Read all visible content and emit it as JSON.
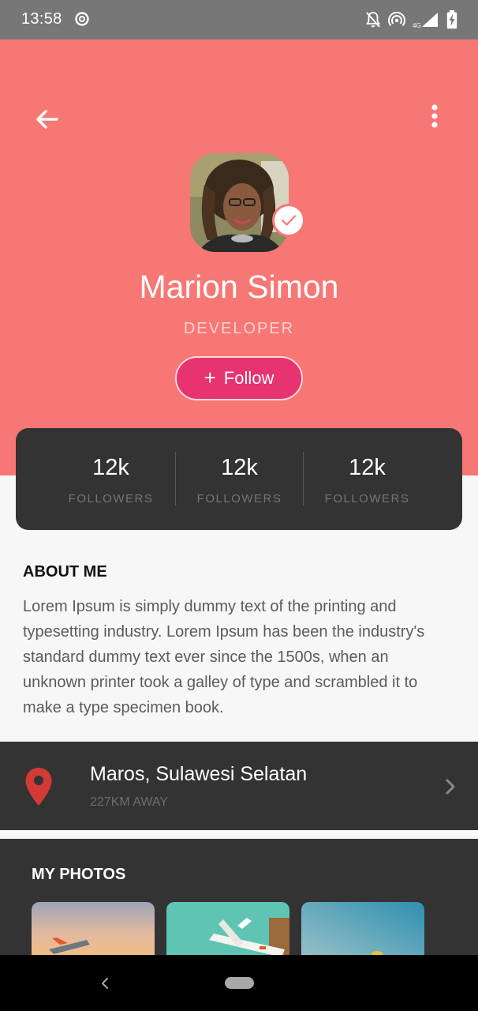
{
  "status_bar": {
    "time": "13:58",
    "network_label": "4G",
    "icons": [
      "sync-icon",
      "notifications-off-icon",
      "hotspot-icon",
      "signal-icon",
      "battery-charging-icon"
    ]
  },
  "header": {
    "back_icon": "arrow-left-icon",
    "more_icon": "more-vertical-icon",
    "background_color": "#f77775"
  },
  "profile": {
    "name": "Marion Simon",
    "role": "DEVELOPER",
    "verified": true,
    "follow_label": "Follow",
    "follow_color": "#e7336f"
  },
  "stats": [
    {
      "value": "12k",
      "label": "FOLLOWERS"
    },
    {
      "value": "12k",
      "label": "FOLLOWERS"
    },
    {
      "value": "12k",
      "label": "FOLLOWERS"
    }
  ],
  "about": {
    "title": "ABOUT ME",
    "text": "Lorem Ipsum is simply dummy text of the printing and typesetting industry. Lorem Ipsum has been the industry's standard dummy text ever since the 1500s, when an unknown printer took a galley of type and scrambled it to make a type specimen book."
  },
  "location": {
    "name": "Maros, Sulawesi Selatan",
    "distance": "227KM AWAY",
    "pin_color": "#d33a33"
  },
  "photos": {
    "title": "MY PHOTOS",
    "items": [
      "sunset-plane-photo",
      "teal-airplane-photo",
      "sky-balloon-photo"
    ]
  },
  "nav": {
    "icons": [
      "nav-back-icon",
      "nav-home-pill"
    ]
  }
}
